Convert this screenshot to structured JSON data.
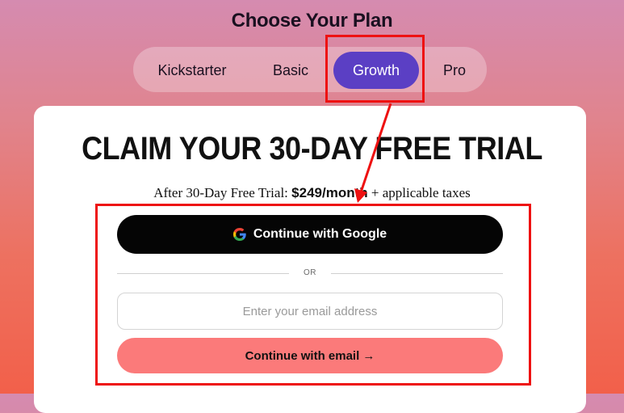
{
  "header": {
    "title": "Choose Your Plan"
  },
  "plan_tabs": [
    {
      "label": "Kickstarter",
      "selected": false
    },
    {
      "label": "Basic",
      "selected": false
    },
    {
      "label": "Growth",
      "selected": true
    },
    {
      "label": "Pro",
      "selected": false
    }
  ],
  "card": {
    "title": "CLAIM YOUR 30-DAY FREE TRIAL",
    "price_prefix": "After 30-Day Free Trial:",
    "price_amount": "$249/month",
    "price_suffix": "+ applicable taxes",
    "google_button_label": "Continue with Google",
    "divider_text": "OR",
    "email_placeholder": "Enter your email address",
    "email_value": "",
    "email_button_label": "Continue with email →"
  },
  "icons": {
    "google": "google-icon",
    "arrow": "arrow-right-icon"
  },
  "colors": {
    "accent_tab": "#5b3fc4",
    "google_button": "#050505",
    "email_button": "#fb7a7a",
    "annotation": "#ee1111"
  }
}
